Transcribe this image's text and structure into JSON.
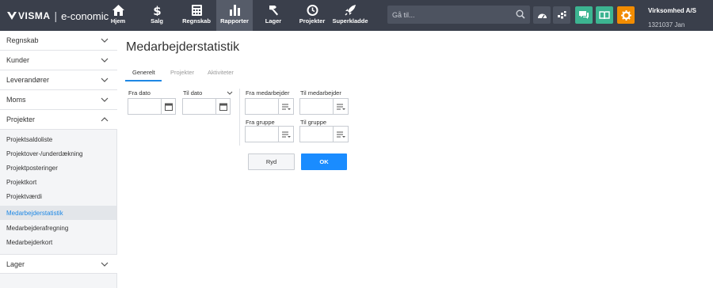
{
  "header": {
    "logo": {
      "brand": "VISMA",
      "separator": "|",
      "product": "e-conomic"
    },
    "nav": [
      {
        "label": "Hjem",
        "icon": "home-icon"
      },
      {
        "label": "Salg",
        "icon": "dollar-icon"
      },
      {
        "label": "Regnskab",
        "icon": "ledger-icon"
      },
      {
        "label": "Rapporter",
        "icon": "bar-chart-icon",
        "active": true
      },
      {
        "label": "Lager",
        "icon": "hammer-icon"
      },
      {
        "label": "Projekter",
        "icon": "clock-icon"
      },
      {
        "label": "Superkladde",
        "icon": "rocket-icon"
      }
    ],
    "search": {
      "placeholder": "Gå til..."
    },
    "icon_buttons": [
      "dashboard-icon",
      "apps-icon",
      "chat-icon",
      "book-icon",
      "settings-icon"
    ],
    "company": {
      "name": "Virksomhed A/S",
      "sub": "1321037 Jan"
    }
  },
  "sidebar": {
    "sections": [
      "Regnskab",
      "Kunder",
      "Leverandører",
      "Moms",
      "Projekter",
      "Lager"
    ],
    "projekter_items": [
      "Projektsaldoliste",
      "Projektover-/underdækning",
      "Projektposteringer",
      "Projektkort",
      "Projektværdi",
      "Medarbejderstatistik",
      "Medarbejderafregning",
      "Medarbejderkort"
    ],
    "active_item": "Medarbejderstatistik"
  },
  "main": {
    "title": "Medarbejderstatistik",
    "tabs": [
      {
        "label": "Generelt",
        "active": true
      },
      {
        "label": "Projekter",
        "active": false
      },
      {
        "label": "Aktiviteter",
        "active": false
      }
    ],
    "form": {
      "from_date": {
        "label": "Fra dato",
        "value": ""
      },
      "to_date": {
        "label": "Til dato",
        "value": ""
      },
      "from_employee": {
        "label": "Fra medarbejder",
        "value": ""
      },
      "to_employee": {
        "label": "Til medarbejder",
        "value": ""
      },
      "from_group": {
        "label": "Fra gruppe",
        "value": ""
      },
      "to_group": {
        "label": "Til gruppe",
        "value": ""
      }
    },
    "buttons": {
      "reset": "Ryd",
      "ok": "OK"
    }
  },
  "colors": {
    "topbar": "#3a3f4b",
    "accent": "#1a8cff",
    "green": "#3cb491",
    "orange": "#f28c00",
    "sidebar_active": "#e3e6ea"
  }
}
